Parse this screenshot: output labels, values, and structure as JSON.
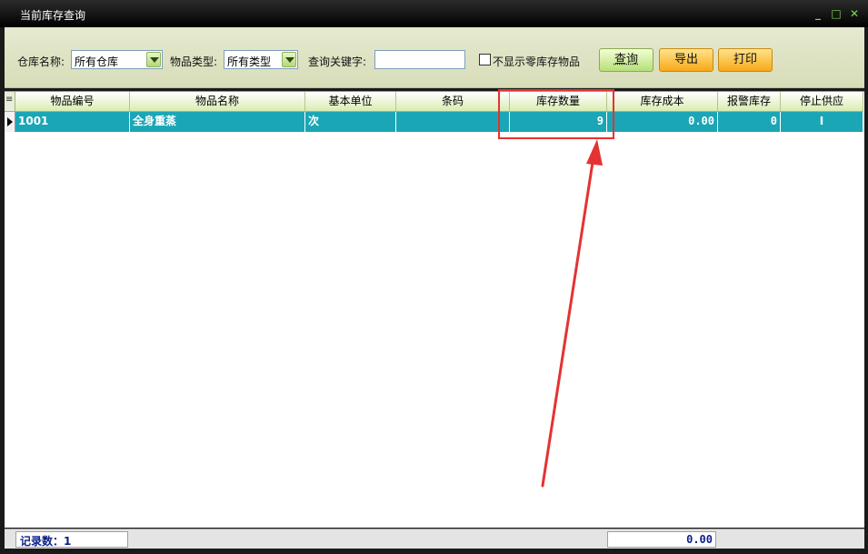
{
  "window": {
    "title": "当前库存查询"
  },
  "toolbar": {
    "warehouse_label": "仓库名称:",
    "warehouse_value": "所有仓库",
    "item_type_label": "物品类型:",
    "item_type_value": "所有类型",
    "keyword_label": "查询关键字:",
    "keyword_value": "",
    "hide_zero_label": "不显示零库存物品",
    "hide_zero_checked": false,
    "query_label": "查询",
    "export_label": "导出",
    "print_label": "打印"
  },
  "table": {
    "columns": [
      "物品编号",
      "物品名称",
      "基本单位",
      "条码",
      "库存数量",
      "库存成本",
      "报警库存",
      "停止供应"
    ],
    "rows": [
      {
        "item_no": "1001",
        "item_name": "全身重蒸",
        "unit": "次",
        "barcode": "",
        "stock_qty": "9",
        "stock_cost": "0.00",
        "alarm_stock": "0",
        "stop_supply": "I"
      }
    ]
  },
  "status": {
    "record_count_label": "记录数：1",
    "total_cost": "0.00"
  },
  "colors": {
    "selected_row": "#1ba6b6",
    "highlight": "#e53232"
  }
}
